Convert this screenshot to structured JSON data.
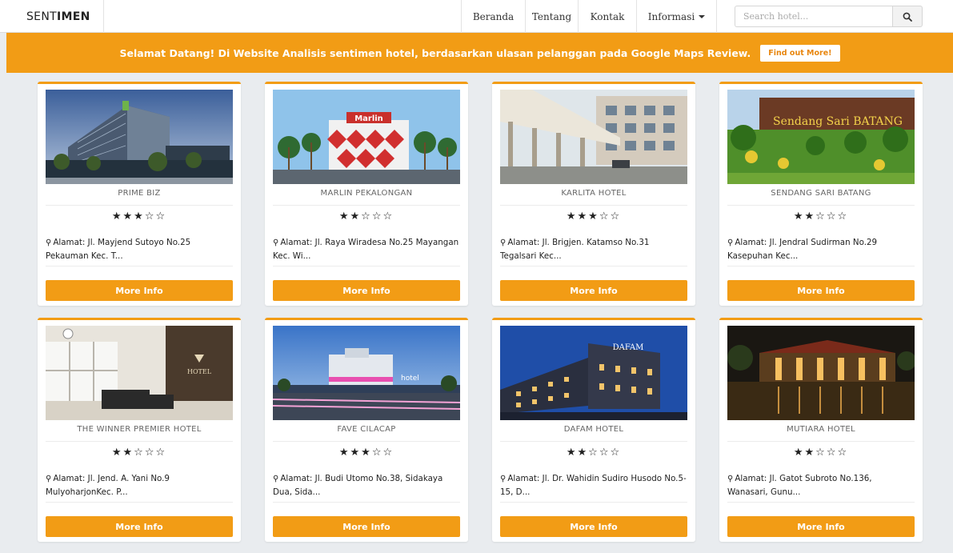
{
  "nav": {
    "brand_light": "SENT",
    "brand_bold": "IMEN",
    "items": [
      {
        "label": "Beranda"
      },
      {
        "label": "Tentang"
      },
      {
        "label": "Kontak"
      },
      {
        "label": "Informasi"
      }
    ],
    "search_placeholder": "Search hotel...",
    "search_icon": "search-icon"
  },
  "banner": {
    "text": "Selamat Datang! Di Website Analisis sentimen hotel, berdasarkan ulasan pelanggan pada Google Maps Review.",
    "button_label": "Find out More!"
  },
  "colors": {
    "accent": "#f29c15",
    "background": "#e9ecef"
  },
  "hotels": [
    {
      "name": "PRIME BIZ",
      "stars": "★★★☆☆",
      "rating": 3,
      "address": "Alamat: Jl. Mayjend Sutoyo No.25 Pekauman Kec. T...",
      "button_label": "More Info"
    },
    {
      "name": "MARLIN PEKALONGAN",
      "stars": "★★☆☆☆",
      "rating": 2,
      "address": "Alamat: Jl. Raya Wiradesa No.25 Mayangan Kec. Wi...",
      "button_label": "More Info"
    },
    {
      "name": "KARLITA HOTEL",
      "stars": "★★★☆☆",
      "rating": 3,
      "address": "Alamat: Jl. Brigjen. Katamso No.31 Tegalsari Kec...",
      "button_label": "More Info"
    },
    {
      "name": "SENDANG SARI BATANG",
      "stars": "★★☆☆☆",
      "rating": 2,
      "address": "Alamat: Jl. Jendral Sudirman No.29 Kasepuhan Kec...",
      "button_label": "More Info"
    },
    {
      "name": "THE WINNER PREMIER HOTEL",
      "stars": "★★☆☆☆",
      "rating": 2,
      "address": "Alamat: Jl. Jend. A. Yani No.9 MulyoharjonKec. P...",
      "button_label": "More Info"
    },
    {
      "name": "FAVE CILACAP",
      "stars": "★★★☆☆",
      "rating": 3,
      "address": "Alamat: Jl. Budi Utomo No.38, Sidakaya Dua, Sida...",
      "button_label": "More Info"
    },
    {
      "name": "DAFAM HOTEL",
      "stars": "★★☆☆☆",
      "rating": 2,
      "address": "Alamat: Jl. Dr. Wahidin Sudiro Husodo No.5-15, D...",
      "button_label": "More Info"
    },
    {
      "name": "MUTIARA HOTEL",
      "stars": "★★☆☆☆",
      "rating": 2,
      "address": "Alamat: Jl. Gatot Subroto No.136, Wanasari, Gunu...",
      "button_label": "More Info"
    }
  ]
}
